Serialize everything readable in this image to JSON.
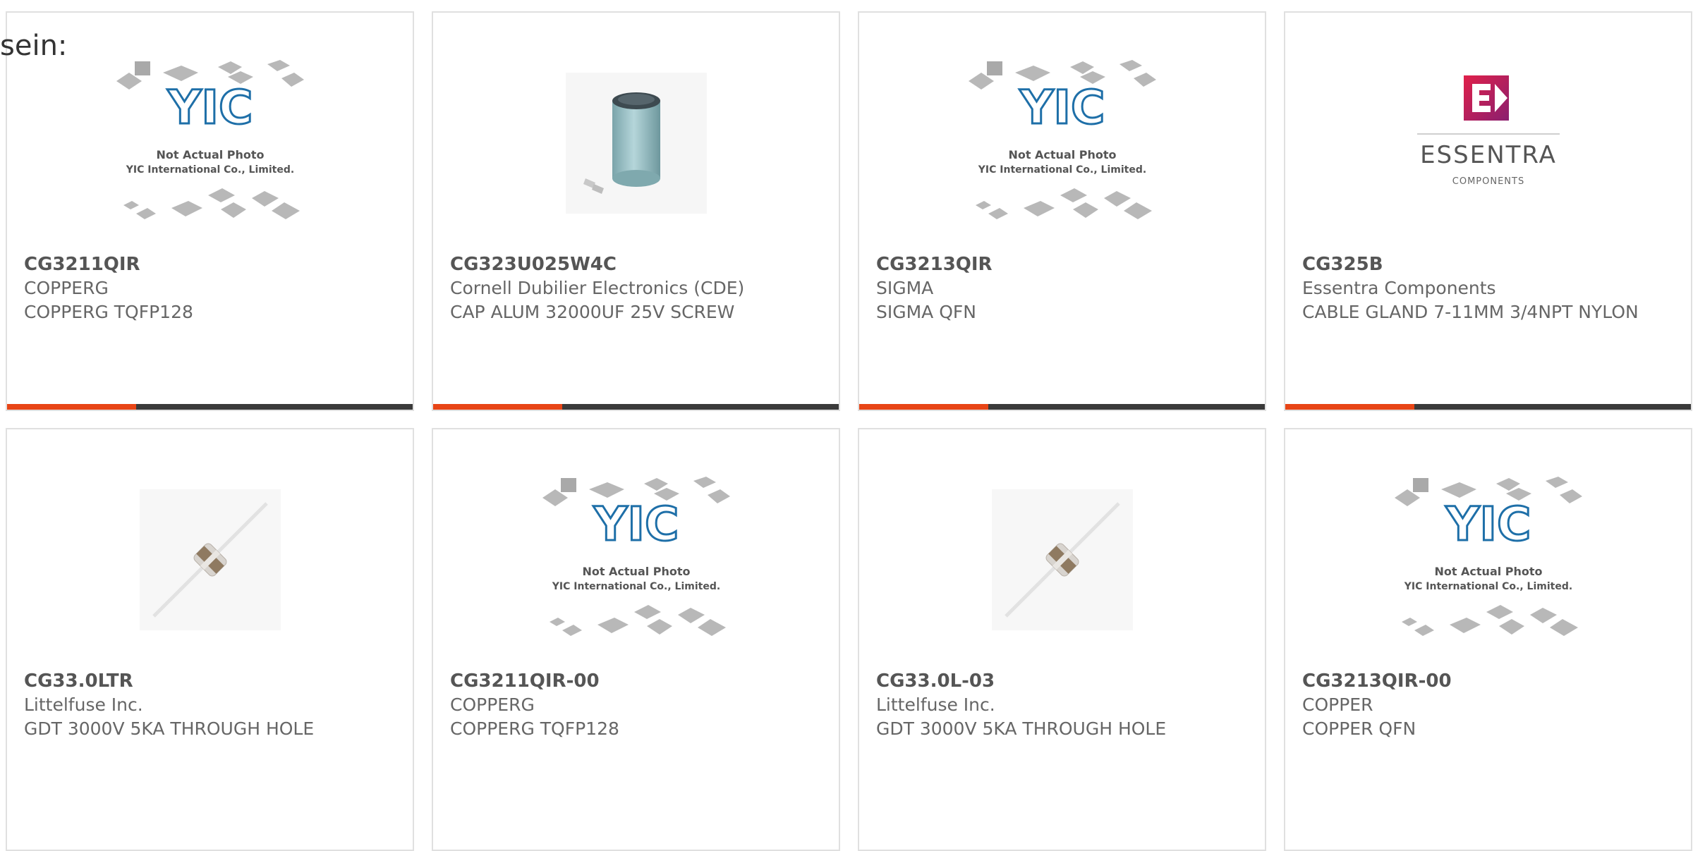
{
  "heading": "sein:",
  "colors": {
    "accent": "#e84516",
    "bar": "#3a3a3a",
    "border": "#e0e0e0"
  },
  "yic_photo": {
    "brand": "YIC",
    "line1": "Not Actual Photo",
    "line2": "YIC International Co., Limited."
  },
  "essentra_logo": {
    "brand": "ESSENTRA",
    "sub": "COMPONENTS"
  },
  "cards": [
    {
      "part": "CG3211QIR",
      "maker": "COPPERG",
      "desc": "COPPERG TQFP128",
      "image": "yic-placeholder"
    },
    {
      "part": "CG323U025W4C",
      "maker": "Cornell Dubilier Electronics (CDE)",
      "desc": "CAP ALUM 32000UF 25V SCREW",
      "image": "capacitor"
    },
    {
      "part": "CG3213QIR",
      "maker": "SIGMA",
      "desc": "SIGMA QFN",
      "image": "yic-placeholder"
    },
    {
      "part": "CG325B",
      "maker": "Essentra Components",
      "desc": "CABLE GLAND 7-11MM 3/4NPT NYLON",
      "image": "essentra-logo"
    },
    {
      "part": "CG33.0LTR",
      "maker": "Littelfuse Inc.",
      "desc": "GDT 3000V 5KA THROUGH HOLE",
      "image": "gdt"
    },
    {
      "part": "CG3211QIR-00",
      "maker": "COPPERG",
      "desc": "COPPERG TQFP128",
      "image": "yic-placeholder"
    },
    {
      "part": "CG33.0L-03",
      "maker": "Littelfuse Inc.",
      "desc": "GDT 3000V 5KA THROUGH HOLE",
      "image": "gdt"
    },
    {
      "part": "CG3213QIR-00",
      "maker": "COPPER",
      "desc": "COPPER QFN",
      "image": "yic-placeholder"
    }
  ]
}
